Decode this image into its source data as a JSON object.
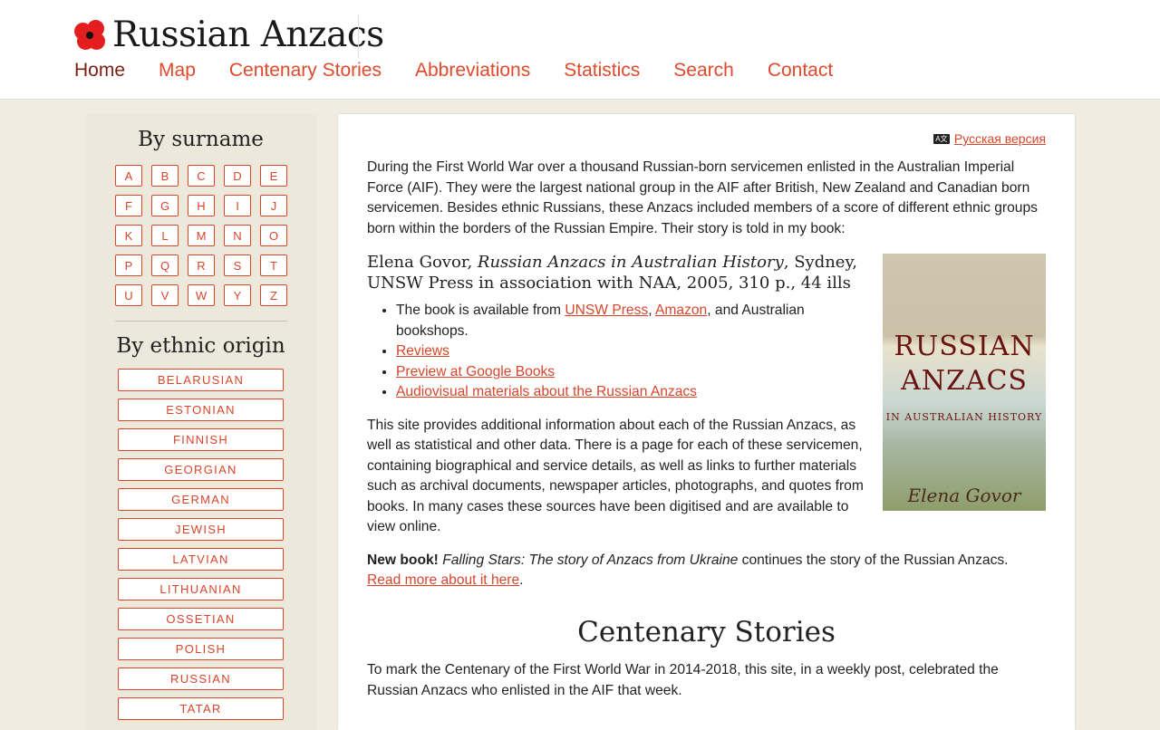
{
  "header": {
    "site_title": "Russian Anzacs",
    "nav": [
      {
        "label": "Home"
      },
      {
        "label": "Map"
      },
      {
        "label": "Centenary Stories"
      },
      {
        "label": "Abbreviations"
      },
      {
        "label": "Statistics"
      },
      {
        "label": "Search"
      },
      {
        "label": "Contact"
      }
    ]
  },
  "sidebar": {
    "surname_heading": "By surname",
    "letters": [
      "A",
      "B",
      "C",
      "D",
      "E",
      "F",
      "G",
      "H",
      "I",
      "J",
      "K",
      "L",
      "M",
      "N",
      "O",
      "P",
      "Q",
      "R",
      "S",
      "T",
      "U",
      "V",
      "W",
      "Y",
      "Z"
    ],
    "ethnic_heading": "By ethnic origin",
    "ethnic": [
      "BELARUSIAN",
      "ESTONIAN",
      "FINNISH",
      "GEORGIAN",
      "GERMAN",
      "JEWISH",
      "LATVIAN",
      "LITHUANIAN",
      "OSSETIAN",
      "POLISH",
      "RUSSIAN",
      "TATAR"
    ]
  },
  "main": {
    "lang_icon_text": "A文",
    "lang_link": "Русская версия",
    "intro": "During the First World War over a thousand Russian-born servicemen enlisted in the Australian Imperial Force (AIF). They were the largest national group in the AIF after British, New Zealand and Canadian born servicemen. Besides ethnic Russians, these Anzacs included members of a score of different ethnic groups born within the borders of the Russian Empire. Their story is told in my book:",
    "citation": {
      "author": "Elena Govor,",
      "title": "Russian Anzacs in Australian History",
      "rest": ", Sydney, UNSW Press in association with NAA, 2005, 310 p., 44 ills"
    },
    "cover": {
      "line1": "RUSSIAN",
      "line2": "ANZACS",
      "line3": "IN AUSTRALIAN HISTORY",
      "author": "Elena Govor"
    },
    "availability": {
      "prefix": "The book is available from ",
      "link1": "UNSW Press",
      "sep": ", ",
      "link2": "Amazon",
      "suffix": ", and Australian bookshops."
    },
    "links": [
      "Reviews",
      "Preview at Google Books",
      "Audiovisual materials about the Russian Anzacs"
    ],
    "description": "This site provides additional information about each of the Russian Anzacs, as well as statistical and other data. There is a page for each of these servicemen, containing biographical and service details, as well as links to further materials such as archival documents, newspaper articles, photographs, and quotes from books. In many cases these sources have been digitised and are available to view online.",
    "new_book": {
      "label": "New book!",
      "title": "Falling Stars: The story of Anzacs from Ukraine",
      "text": " continues the story of the Russian Anzacs.",
      "read_more": "Read more about it here",
      "period": "."
    },
    "centenary_heading": "Centenary Stories",
    "centenary_text": "To mark the Centenary of the First World War in 2014-2018, this site, in a weekly post, celebrated the Russian Anzacs who enlisted in the AIF that week."
  }
}
